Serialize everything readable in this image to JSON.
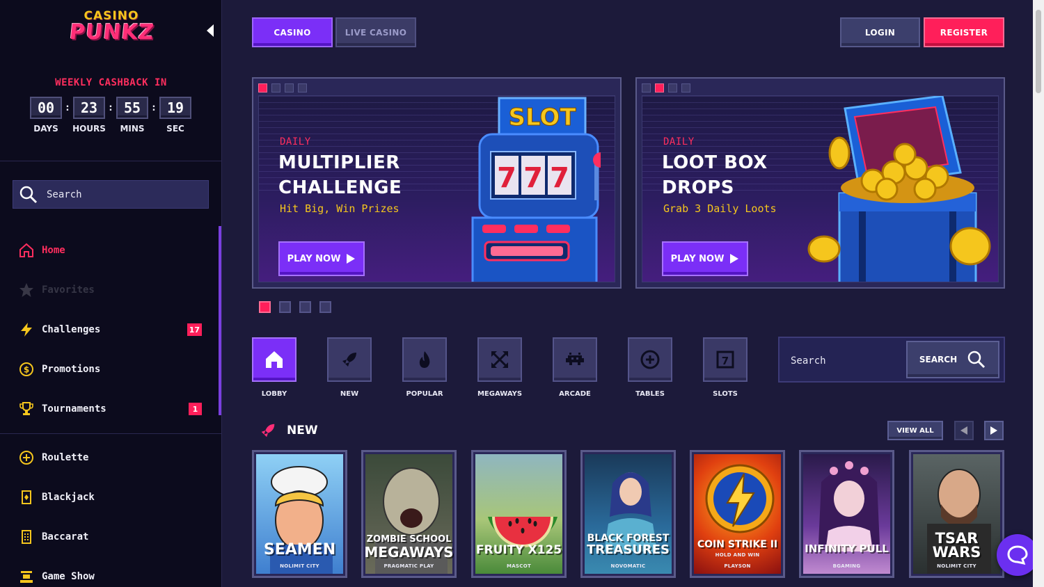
{
  "sidebar": {
    "logo": {
      "line1": "CASINO",
      "line2": "PUNKZ"
    },
    "cashback": {
      "title": "WEEKLY CASHBACK IN",
      "units": [
        {
          "value": "00",
          "label": "DAYS"
        },
        {
          "value": "23",
          "label": "HOURS"
        },
        {
          "value": "55",
          "label": "MINS"
        },
        {
          "value": "19",
          "label": "SEC"
        }
      ],
      "separator": ":"
    },
    "search": {
      "label": "Search"
    },
    "nav": [
      {
        "label": "Home",
        "icon": "home-icon",
        "active": true
      },
      {
        "label": "Favorites",
        "icon": "star-icon",
        "active": false
      },
      {
        "label": "Challenges",
        "icon": "lightning-icon",
        "badge": "17"
      },
      {
        "label": "Promotions",
        "icon": "dollar-coin-icon"
      },
      {
        "label": "Tournaments",
        "icon": "trophy-icon",
        "badge": "1"
      }
    ],
    "games_nav": [
      {
        "label": "Roulette",
        "icon": "roulette-icon"
      },
      {
        "label": "Blackjack",
        "icon": "card-icon"
      },
      {
        "label": "Baccarat",
        "icon": "dice-card-icon"
      },
      {
        "label": "Game Show",
        "icon": "gameshow-icon"
      }
    ]
  },
  "topbar": {
    "tabs": [
      {
        "label": "CASINO",
        "active": true
      },
      {
        "label": "LIVE CASINO",
        "active": false
      }
    ],
    "login": "LOGIN",
    "register": "REGISTER"
  },
  "banners": [
    {
      "kicker": "DAILY",
      "title_line1": "MULTIPLIER",
      "title_line2": "CHALLENGE",
      "subtitle": "Hit Big, Win Prizes",
      "cta": "PLAY NOW",
      "art": "slot-machine-art",
      "art_label": "SLOT",
      "active_dot": 0
    },
    {
      "kicker": "DAILY",
      "title_line1": "LOOT BOX",
      "title_line2": "DROPS",
      "subtitle": "Grab 3 Daily Loots",
      "cta": "PLAY NOW",
      "art": "treasure-chest-art",
      "active_dot": 1
    }
  ],
  "carousel_pager": {
    "count": 4,
    "active": 0
  },
  "categories": [
    {
      "label": "LOBBY",
      "icon": "home-icon",
      "active": true
    },
    {
      "label": "NEW",
      "icon": "rocket-icon"
    },
    {
      "label": "POPULAR",
      "icon": "fire-icon"
    },
    {
      "label": "MEGAWAYS",
      "icon": "arrows-expand-icon"
    },
    {
      "label": "ARCADE",
      "icon": "invader-icon"
    },
    {
      "label": "TABLES",
      "icon": "chip-icon"
    },
    {
      "label": "SLOTS",
      "icon": "slot-icon"
    }
  ],
  "main_search": {
    "label": "Search",
    "button": "SEARCH"
  },
  "section_new": {
    "title": "NEW",
    "view_all": "VIEW ALL",
    "games": [
      {
        "title": "SEAMEN",
        "provider": "NOLIMIT CITY",
        "bg": "#3f7fcf"
      },
      {
        "title": "ZOMBIE SCHOOL MEGAWAYS",
        "title_line1": "ZOMBIE SCHOOL",
        "title_line2": "MEGAWAYS",
        "provider": "PRAGMATIC PLAY",
        "bg": "#4a5a3a"
      },
      {
        "title": "FRUITY X125",
        "provider": "MASCOT",
        "bg": "#6aa24a"
      },
      {
        "title": "BLACK FOREST TREASURES",
        "title_line1": "BLACK FOREST",
        "title_line2": "TREASURES",
        "provider": "NOVOMATIC",
        "bg": "#2a6a9a"
      },
      {
        "title": "COIN STRIKE II",
        "subtitle": "HOLD AND WIN",
        "provider": "PLAYSON",
        "bg": "#c22a1a"
      },
      {
        "title": "INFINITY PULL",
        "provider": "BGAMING",
        "bg": "#5a3a8a"
      },
      {
        "title": "TSAR WARS",
        "title_line1": "TSAR",
        "title_line2": "WARS",
        "provider": "NOLIMIT CITY",
        "bg": "#3a4040"
      }
    ]
  },
  "colors": {
    "accent": "#7b2ff7",
    "brand_pink": "#ff1f5a",
    "gold": "#f5c61d",
    "sidebar_bg": "#0c0b1d",
    "main_bg": "#1c1a3a"
  }
}
